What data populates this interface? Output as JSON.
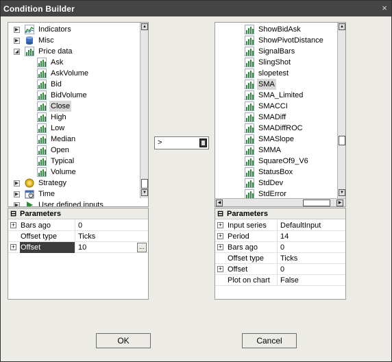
{
  "window": {
    "title": "Condition Builder",
    "close_glyph": "×"
  },
  "left_tree": [
    {
      "label": "Indicators",
      "icon": "indicator-chart-icon",
      "expander": "▶",
      "level": 0
    },
    {
      "label": "Misc",
      "icon": "database-icon",
      "expander": "▶",
      "level": 0
    },
    {
      "label": "Price data",
      "icon": "bar-chart-icon",
      "expander": "◢",
      "level": 0
    },
    {
      "label": "Ask",
      "icon": "bar-chart-icon",
      "level": 1
    },
    {
      "label": "AskVolume",
      "icon": "bar-chart-icon",
      "level": 1
    },
    {
      "label": "Bid",
      "icon": "bar-chart-icon",
      "level": 1
    },
    {
      "label": "BidVolume",
      "icon": "bar-chart-icon",
      "level": 1
    },
    {
      "label": "Close",
      "icon": "bar-chart-icon",
      "level": 1,
      "selected": true
    },
    {
      "label": "High",
      "icon": "bar-chart-icon",
      "level": 1
    },
    {
      "label": "Low",
      "icon": "bar-chart-icon",
      "level": 1
    },
    {
      "label": "Median",
      "icon": "bar-chart-icon",
      "level": 1
    },
    {
      "label": "Open",
      "icon": "bar-chart-icon",
      "level": 1
    },
    {
      "label": "Typical",
      "icon": "bar-chart-icon",
      "level": 1
    },
    {
      "label": "Volume",
      "icon": "bar-chart-icon",
      "level": 1
    },
    {
      "label": "Strategy",
      "icon": "strategy-icon",
      "expander": "▶",
      "level": 0
    },
    {
      "label": "Time",
      "icon": "calendar-icon",
      "expander": "▶",
      "level": 0
    },
    {
      "label": "User defined inputs",
      "icon": "play-icon",
      "expander": "▶",
      "level": 0
    }
  ],
  "right_tree": [
    {
      "label": "ShowBidAsk"
    },
    {
      "label": "ShowPivotDistance"
    },
    {
      "label": "SignalBars"
    },
    {
      "label": "SlingShot"
    },
    {
      "label": "slopetest"
    },
    {
      "label": "SMA",
      "selected": true
    },
    {
      "label": "SMA_Limited"
    },
    {
      "label": "SMACCI"
    },
    {
      "label": "SMADiff"
    },
    {
      "label": "SMADiffROC"
    },
    {
      "label": "SMASlope"
    },
    {
      "label": "SMMA"
    },
    {
      "label": "SquareOf9_V6"
    },
    {
      "label": "StatusBox"
    },
    {
      "label": "StdDev"
    },
    {
      "label": "StdError"
    }
  ],
  "operator": {
    "value": ">"
  },
  "left_params": {
    "header": "Parameters",
    "collapse_glyph": "⊟",
    "rows": [
      {
        "name": "Bars ago",
        "value": "0",
        "expandable": true
      },
      {
        "name": "Offset type",
        "value": "Ticks",
        "expandable": false
      },
      {
        "name": "Offset",
        "value": "10",
        "expandable": true,
        "selected": true,
        "ellipsis": "..."
      }
    ]
  },
  "right_params": {
    "header": "Parameters",
    "rows": [
      {
        "name": "Input series",
        "value": "DefaultInput",
        "expandable": true
      },
      {
        "name": "Period",
        "value": "14",
        "expandable": true
      },
      {
        "name": "Bars ago",
        "value": "0",
        "expandable": true
      },
      {
        "name": "Offset type",
        "value": "Ticks",
        "expandable": false
      },
      {
        "name": "Offset",
        "value": "0",
        "expandable": true
      },
      {
        "name": "Plot on chart",
        "value": "False",
        "expandable": false
      }
    ]
  },
  "buttons": {
    "ok": "OK",
    "cancel": "Cancel"
  },
  "scroll_glyphs": {
    "up": "▲",
    "down": "▼",
    "left": "◀",
    "right": "▶"
  },
  "colors": {
    "titlebar": "#454545",
    "selection": "#d8d8d8",
    "grid_selection": "#3c3c3c",
    "icon_green": "#2a8a3a",
    "icon_blue": "#3a6fbf"
  }
}
